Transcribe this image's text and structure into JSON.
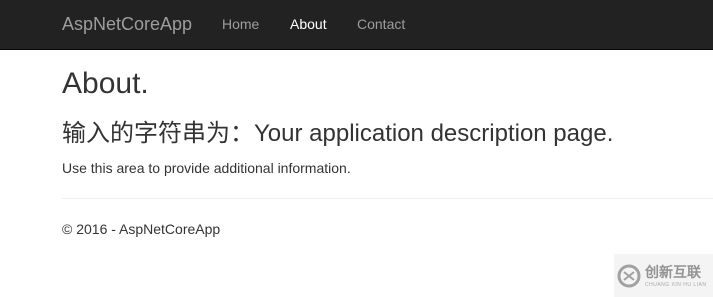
{
  "navbar": {
    "brand": "AspNetCoreApp",
    "links": [
      {
        "label": "Home",
        "active": false
      },
      {
        "label": "About",
        "active": true
      },
      {
        "label": "Contact",
        "active": false
      }
    ]
  },
  "main": {
    "title": "About.",
    "subtitle": "输入的字符串为：Your application description page.",
    "info": "Use this area to provide additional information."
  },
  "footer": {
    "text": "© 2016 - AspNetCoreApp"
  },
  "watermark": {
    "text": "创新互联",
    "subtext": "CHUANG XIN HU LIAN",
    "icon": "chuangxin-logo-icon"
  },
  "colors": {
    "navbar_bg": "#222222",
    "nav_text": "#9d9d9d",
    "nav_active": "#ffffff",
    "body_text": "#333333"
  }
}
